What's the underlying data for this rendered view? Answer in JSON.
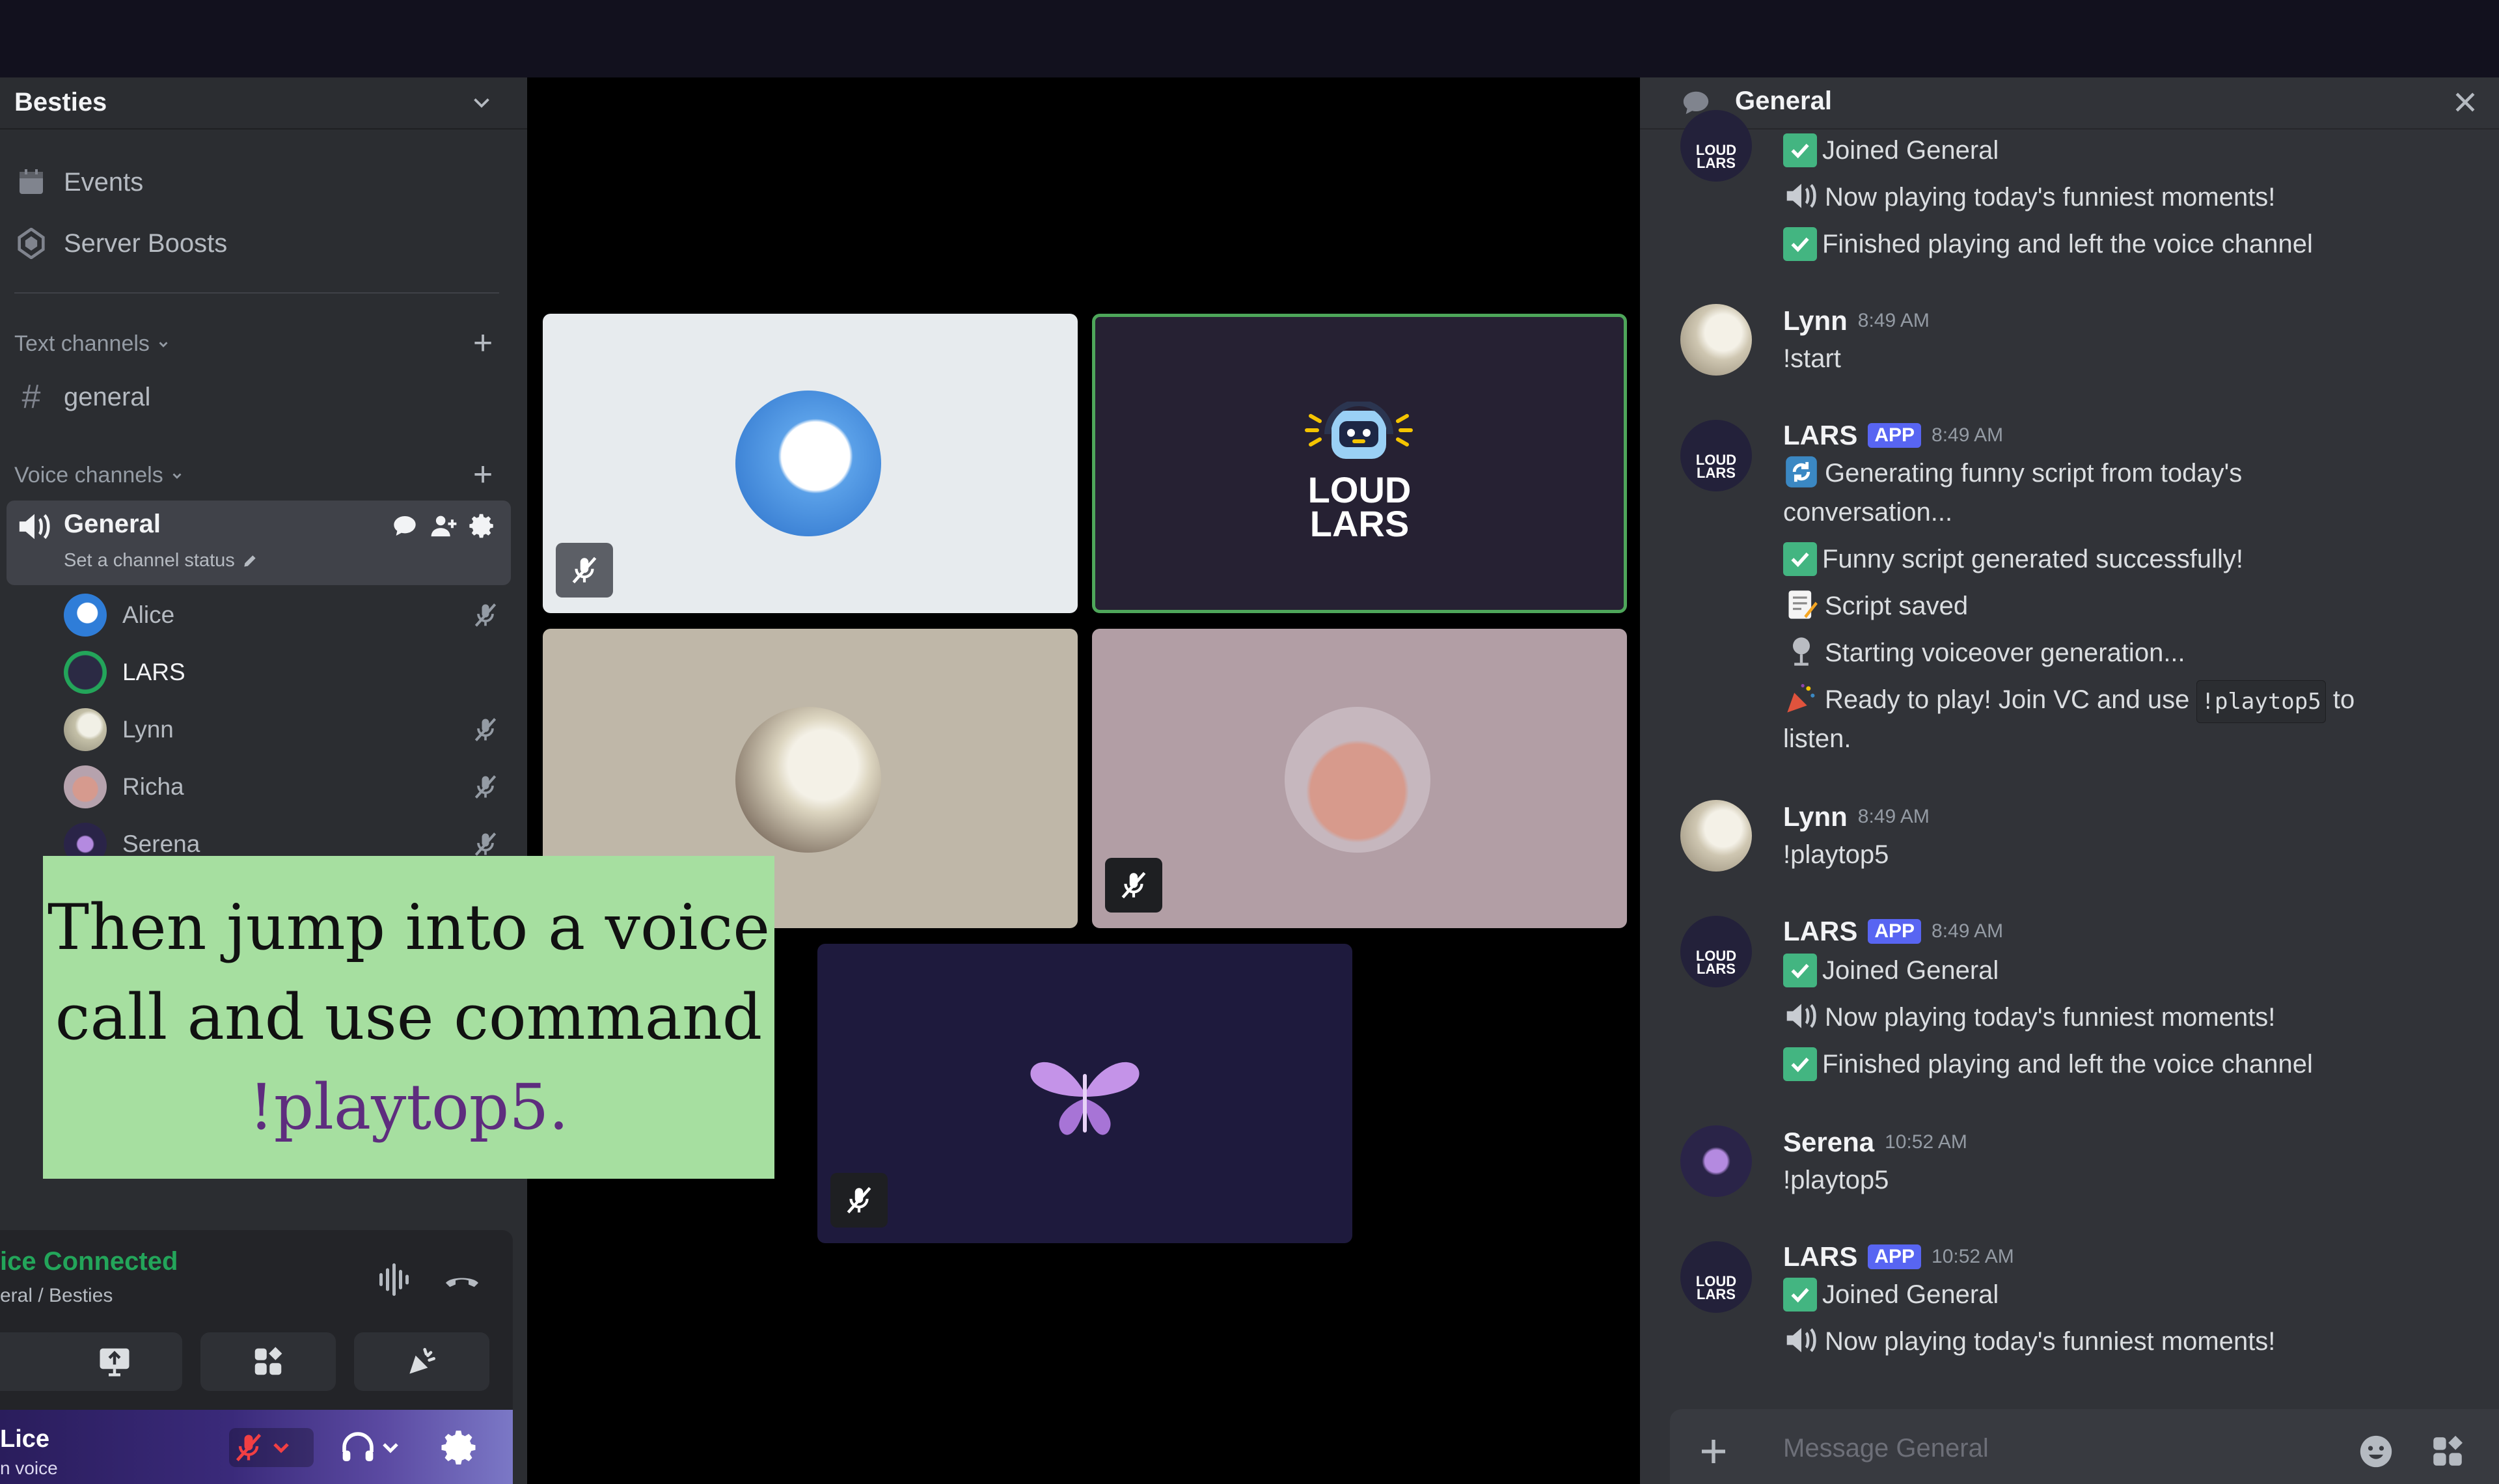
{
  "sidebar": {
    "server_name": "Besties",
    "events_label": "Events",
    "boosts_label": "Server Boosts",
    "text_channels_label": "Text channels",
    "text_channel": "general",
    "voice_channels_label": "Voice channels",
    "voice_channel": "General",
    "channel_status_placeholder": "Set a channel status",
    "members": [
      "Alice",
      "LARS",
      "Lynn",
      "Richa",
      "Serena"
    ]
  },
  "voice_panel": {
    "connected": "ice Connected",
    "location": "eral / Besties",
    "user_name": "Lice",
    "user_status": "n voice"
  },
  "caption": {
    "line1": "Then jump into a voice",
    "line2": "call and use command",
    "line3": "!playtop5."
  },
  "tiles": {
    "lars_logo_line1": "LOUD",
    "lars_logo_line2": "LARS"
  },
  "chat": {
    "title": "General",
    "app_tag": "APP",
    "msg0": {
      "lines": [
        "Joined General",
        "Now playing today's funniest moments!",
        "Finished playing and left the voice channel"
      ]
    },
    "msg1": {
      "author": "Lynn",
      "time": "8:49 AM",
      "text": "!start"
    },
    "msg2": {
      "author": "LARS",
      "time": "8:49 AM",
      "line1": "Generating funny script from today's",
      "line1b": "conversation...",
      "line2": "Funny script generated successfully!",
      "line3": "Script saved",
      "line4": "Starting voiceover generation...",
      "line5a": "Ready to play! Join VC and use",
      "line5code": "!playtop5",
      "line5b": "to",
      "line5c": "listen."
    },
    "msg3": {
      "author": "Lynn",
      "time": "8:49 AM",
      "text": "!playtop5"
    },
    "msg4": {
      "author": "LARS",
      "time": "8:49 AM",
      "lines": [
        "Joined General",
        "Now playing today's funniest moments!",
        "Finished playing and left the voice channel"
      ]
    },
    "msg5": {
      "author": "Serena",
      "time": "10:52 AM",
      "text": "!playtop5"
    },
    "msg6": {
      "author": "LARS",
      "time": "10:52 AM",
      "lines": [
        "Joined General",
        "Now playing today's funniest moments!"
      ]
    },
    "composer_placeholder": "Message General"
  },
  "colors": {
    "accent_green": "#23a55a",
    "app_tag": "#5865f2",
    "caption_bg": "#a6dfa0",
    "speaking_border": "#4ea65a"
  }
}
